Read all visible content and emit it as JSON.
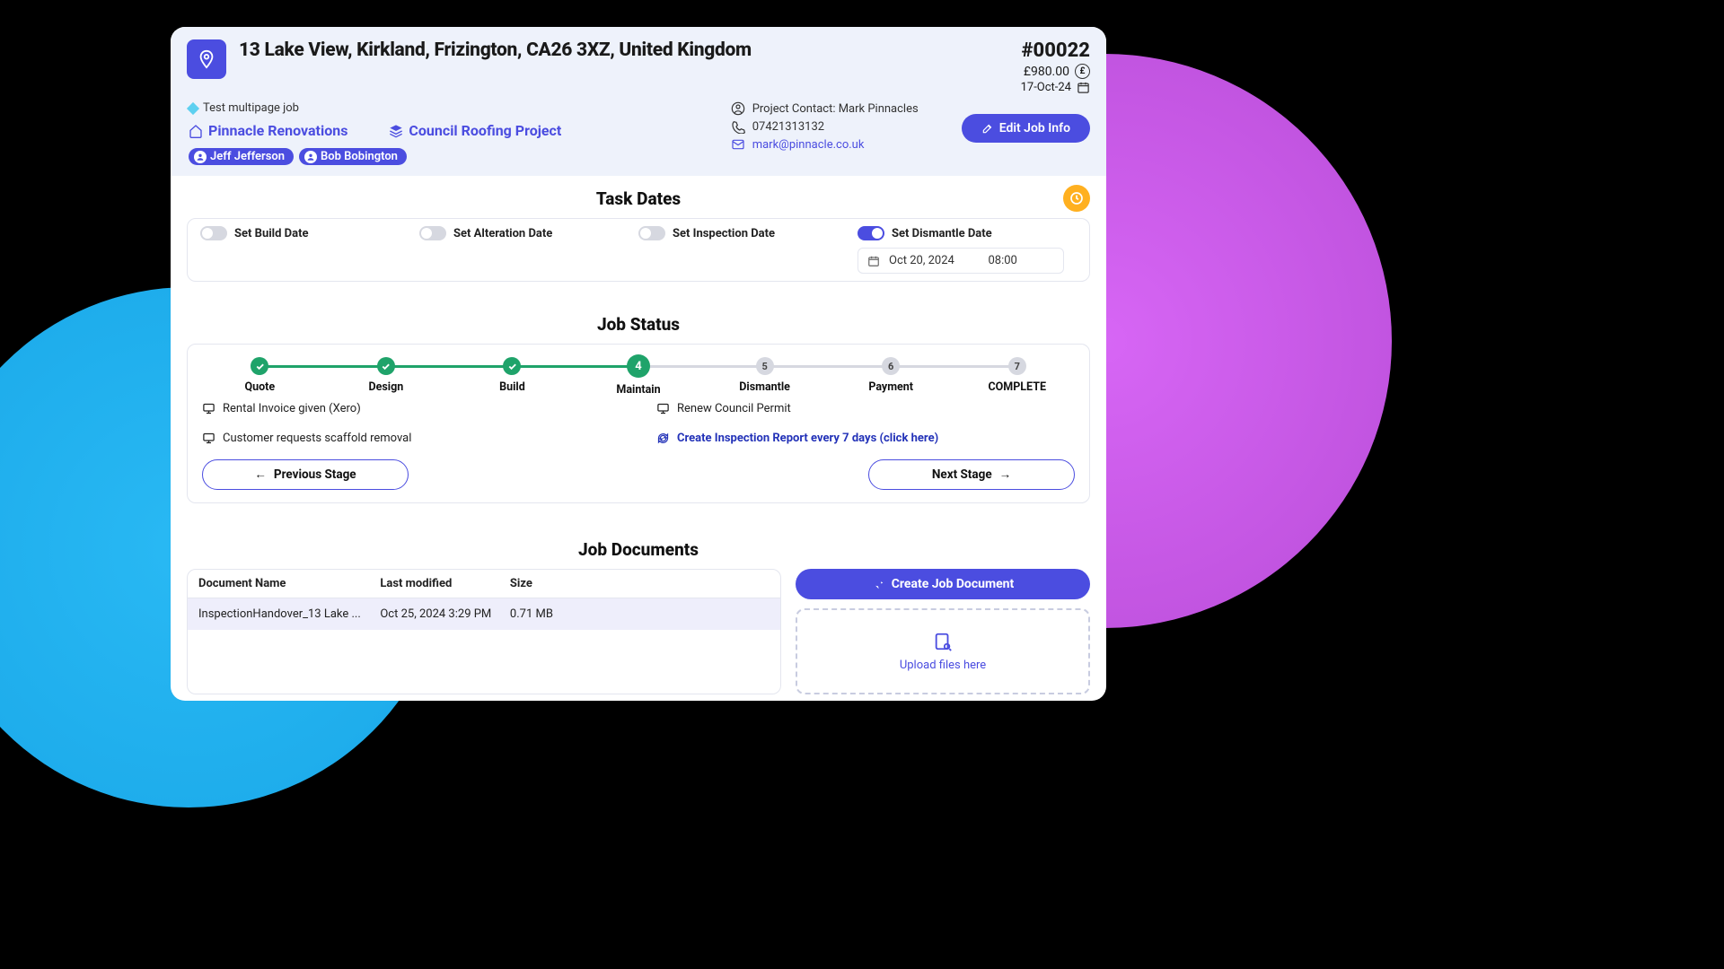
{
  "header": {
    "address": "13 Lake View, Kirkland, Frizington, CA26 3XZ, United Kingdom",
    "job_number": "#00022",
    "price": "£980.00",
    "currency_symbol": "£",
    "date": "17-Oct-24",
    "tag": "Test multipage job",
    "company": "Pinnacle Renovations",
    "project": "Council Roofing Project",
    "people": [
      "Jeff Jefferson",
      "Bob Bobington"
    ],
    "contact": {
      "label": "Project Contact: Mark Pinnacles",
      "phone": "07421313132",
      "email": "mark@pinnacle.co.uk"
    },
    "edit_label": "Edit Job Info"
  },
  "task_dates": {
    "title": "Task Dates",
    "items": [
      {
        "label": "Set Build Date",
        "on": false
      },
      {
        "label": "Set Alteration Date",
        "on": false
      },
      {
        "label": "Set Inspection Date",
        "on": false
      },
      {
        "label": "Set Dismantle Date",
        "on": true,
        "date": "Oct 20, 2024",
        "time": "08:00"
      }
    ]
  },
  "job_status": {
    "title": "Job Status",
    "steps": [
      {
        "label": "Quote",
        "state": "done"
      },
      {
        "label": "Design",
        "state": "done"
      },
      {
        "label": "Build",
        "state": "done"
      },
      {
        "label": "Maintain",
        "state": "current",
        "num": "4"
      },
      {
        "label": "Dismantle",
        "state": "pending",
        "num": "5"
      },
      {
        "label": "Payment",
        "state": "pending",
        "num": "6"
      },
      {
        "label": "COMPLETE",
        "state": "pending",
        "num": "7"
      }
    ],
    "notes_left": [
      "Rental Invoice given (Xero)",
      "Customer requests scaffold removal"
    ],
    "notes_right": [
      "Renew Council Permit",
      "Create Inspection Report every 7 days (click here)"
    ],
    "prev_label": "Previous Stage",
    "next_label": "Next Stage"
  },
  "documents": {
    "title": "Job Documents",
    "columns": [
      "Document Name",
      "Last modified",
      "Size"
    ],
    "rows": [
      {
        "name": "InspectionHandover_13 Lake ...",
        "modified": "Oct 25, 2024 3:29 PM",
        "size": "0.71 MB"
      }
    ],
    "create_label": "Create Job Document",
    "upload_label": "Upload files here"
  }
}
